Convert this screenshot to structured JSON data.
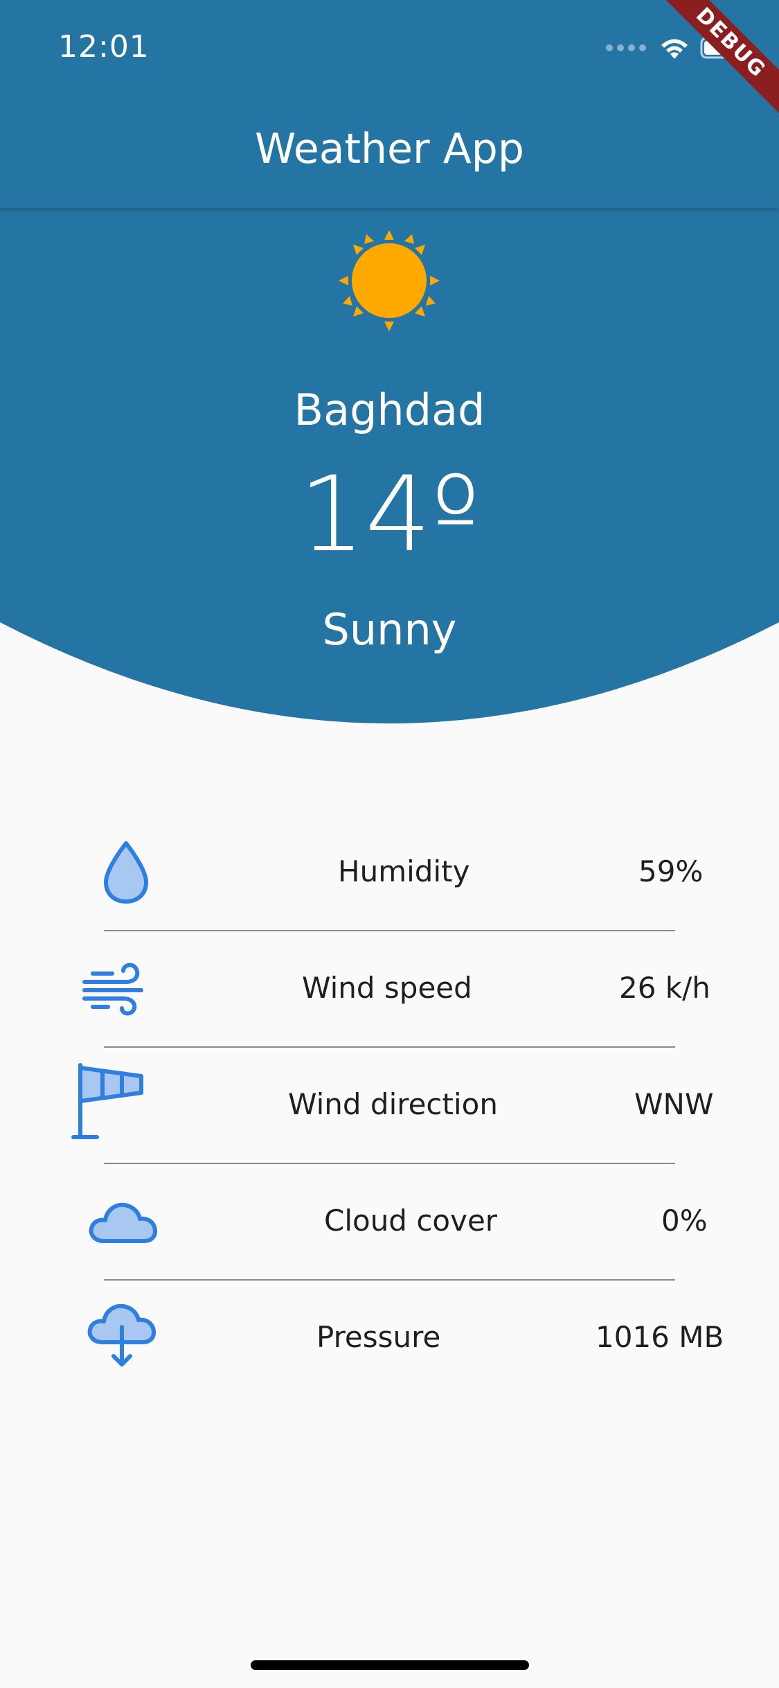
{
  "status_bar": {
    "time": "12:01"
  },
  "debug_banner": "DEBUG",
  "app_bar": {
    "title": "Weather App"
  },
  "weather": {
    "icon": "sun-icon",
    "city": "Baghdad",
    "temperature": "14º",
    "condition": "Sunny"
  },
  "details": [
    {
      "icon": "droplet-icon",
      "label": "Humidity",
      "value": "59%"
    },
    {
      "icon": "wind-icon",
      "label": "Wind speed",
      "value": "26 k/h"
    },
    {
      "icon": "windsock-icon",
      "label": "Wind direction",
      "value": "WNW"
    },
    {
      "icon": "cloud-icon",
      "label": "Cloud cover",
      "value": "0%"
    },
    {
      "icon": "cloud-download-icon",
      "label": "Pressure",
      "value": "1016 MB"
    }
  ],
  "colors": {
    "primary": "#2474a4",
    "sun": "#ffa800",
    "icon_blue": "#2f7fe0",
    "icon_fill": "#a8c8f2",
    "background": "#fafafa"
  }
}
